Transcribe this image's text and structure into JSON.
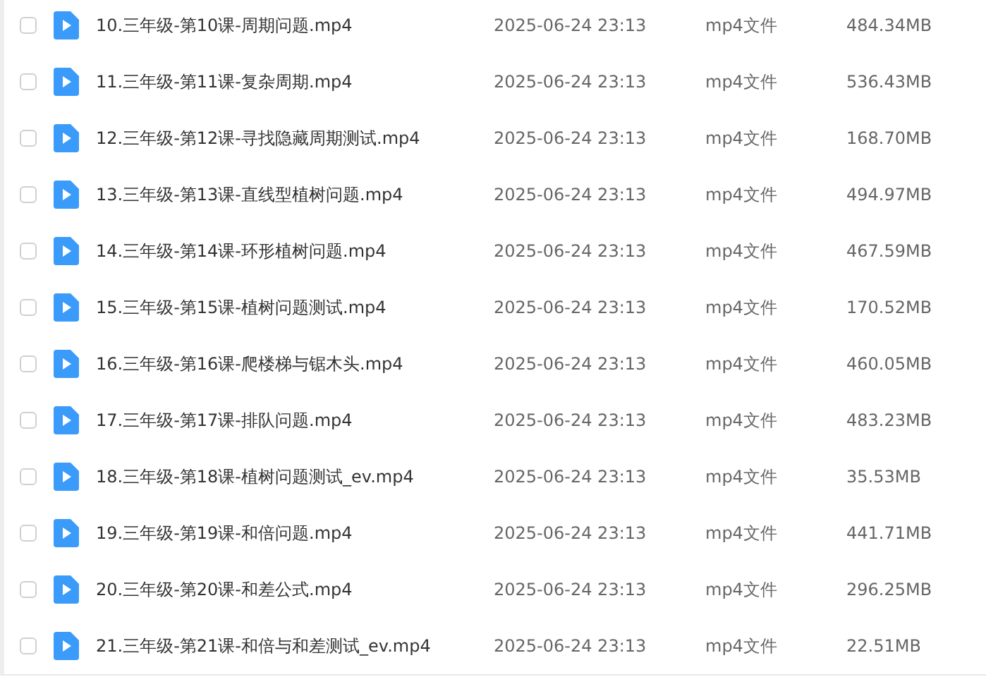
{
  "files": [
    {
      "name": "10.三年级-第10课-周期问题.mp4",
      "modified": "2025-06-24 23:13",
      "type": "mp4文件",
      "size": "484.34MB",
      "checked": false
    },
    {
      "name": "11.三年级-第11课-复杂周期.mp4",
      "modified": "2025-06-24 23:13",
      "type": "mp4文件",
      "size": "536.43MB",
      "checked": false
    },
    {
      "name": "12.三年级-第12课-寻找隐藏周期测试.mp4",
      "modified": "2025-06-24 23:13",
      "type": "mp4文件",
      "size": "168.70MB",
      "checked": false
    },
    {
      "name": "13.三年级-第13课-直线型植树问题.mp4",
      "modified": "2025-06-24 23:13",
      "type": "mp4文件",
      "size": "494.97MB",
      "checked": false
    },
    {
      "name": "14.三年级-第14课-环形植树问题.mp4",
      "modified": "2025-06-24 23:13",
      "type": "mp4文件",
      "size": "467.59MB",
      "checked": false
    },
    {
      "name": "15.三年级-第15课-植树问题测试.mp4",
      "modified": "2025-06-24 23:13",
      "type": "mp4文件",
      "size": "170.52MB",
      "checked": false
    },
    {
      "name": "16.三年级-第16课-爬楼梯与锯木头.mp4",
      "modified": "2025-06-24 23:13",
      "type": "mp4文件",
      "size": "460.05MB",
      "checked": false
    },
    {
      "name": "17.三年级-第17课-排队问题.mp4",
      "modified": "2025-06-24 23:13",
      "type": "mp4文件",
      "size": "483.23MB",
      "checked": false
    },
    {
      "name": "18.三年级-第18课-植树问题测试_ev.mp4",
      "modified": "2025-06-24 23:13",
      "type": "mp4文件",
      "size": "35.53MB",
      "checked": false
    },
    {
      "name": "19.三年级-第19课-和倍问题.mp4",
      "modified": "2025-06-24 23:13",
      "type": "mp4文件",
      "size": "441.71MB",
      "checked": false
    },
    {
      "name": "20.三年级-第20课-和差公式.mp4",
      "modified": "2025-06-24 23:13",
      "type": "mp4文件",
      "size": "296.25MB",
      "checked": false
    },
    {
      "name": "21.三年级-第21课-和倍与和差测试_ev.mp4",
      "modified": "2025-06-24 23:13",
      "type": "mp4文件",
      "size": "22.51MB",
      "checked": false
    }
  ]
}
